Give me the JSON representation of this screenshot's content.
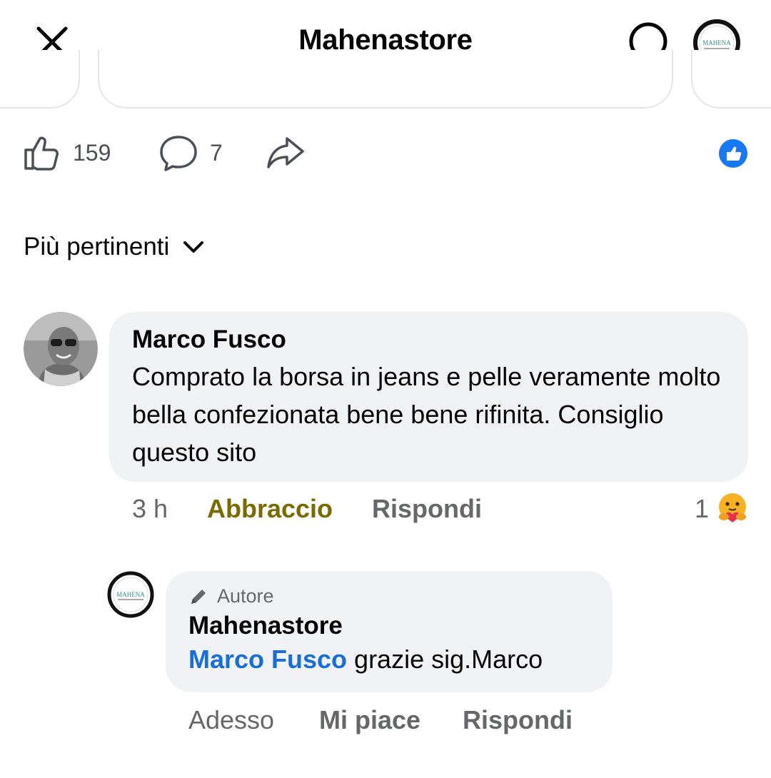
{
  "header": {
    "title": "Mahenastore",
    "close_icon": "close-icon",
    "search_icon": "search-icon",
    "profile_icon": "profile-avatar"
  },
  "actions": {
    "like_count": "159",
    "comment_count": "7",
    "share_icon": "share-icon",
    "reaction_summary_icon": "like-reaction-icon"
  },
  "sort": {
    "label": "Più pertinenti"
  },
  "comments": [
    {
      "author": "Marco Fusco",
      "text": "Comprato la borsa in jeans e pelle veramente molto bella confezionata bene bene rifinita. Consiglio questo sito",
      "time": "3 h",
      "reaction_action": "Abbraccio",
      "reply_action": "Rispondi",
      "reaction_count": "1",
      "reaction_icon": "care-reaction-icon",
      "reaction_color": "#7a6b00"
    }
  ],
  "reply": {
    "badge": "Autore",
    "author": "Mahenastore",
    "mention": "Marco Fusco",
    "text": " grazie sig.Marco",
    "time": "Adesso",
    "like_action": "Mi piace",
    "reply_action": "Rispondi",
    "mention_color": "#1a6ed8"
  },
  "logo_text": "MAHENA"
}
